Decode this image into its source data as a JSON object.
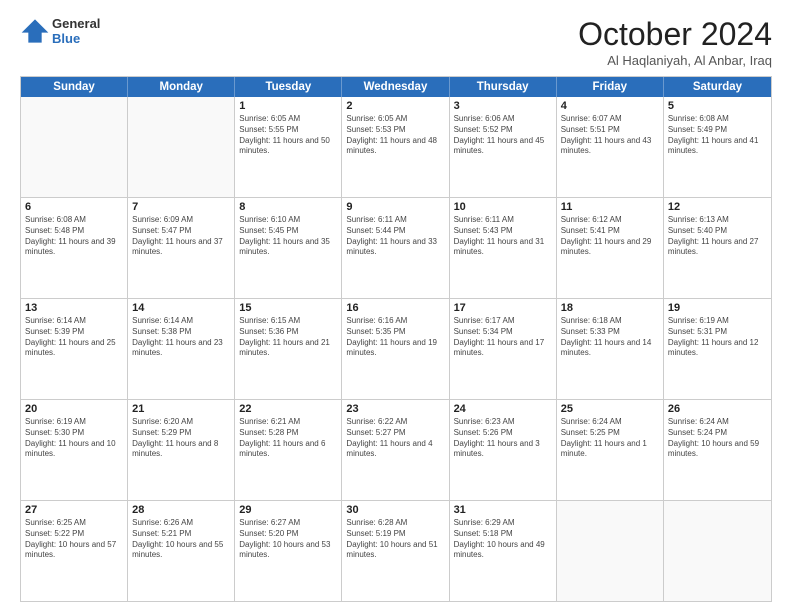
{
  "header": {
    "logo_general": "General",
    "logo_blue": "Blue",
    "month_title": "October 2024",
    "location": "Al Haqlaniyah, Al Anbar, Iraq"
  },
  "days_of_week": [
    "Sunday",
    "Monday",
    "Tuesday",
    "Wednesday",
    "Thursday",
    "Friday",
    "Saturday"
  ],
  "weeks": [
    [
      {
        "day": "",
        "empty": true
      },
      {
        "day": "",
        "empty": true
      },
      {
        "day": "1",
        "rise": "Sunrise: 6:05 AM",
        "set": "Sunset: 5:55 PM",
        "daylight": "Daylight: 11 hours and 50 minutes."
      },
      {
        "day": "2",
        "rise": "Sunrise: 6:05 AM",
        "set": "Sunset: 5:53 PM",
        "daylight": "Daylight: 11 hours and 48 minutes."
      },
      {
        "day": "3",
        "rise": "Sunrise: 6:06 AM",
        "set": "Sunset: 5:52 PM",
        "daylight": "Daylight: 11 hours and 45 minutes."
      },
      {
        "day": "4",
        "rise": "Sunrise: 6:07 AM",
        "set": "Sunset: 5:51 PM",
        "daylight": "Daylight: 11 hours and 43 minutes."
      },
      {
        "day": "5",
        "rise": "Sunrise: 6:08 AM",
        "set": "Sunset: 5:49 PM",
        "daylight": "Daylight: 11 hours and 41 minutes."
      }
    ],
    [
      {
        "day": "6",
        "rise": "Sunrise: 6:08 AM",
        "set": "Sunset: 5:48 PM",
        "daylight": "Daylight: 11 hours and 39 minutes."
      },
      {
        "day": "7",
        "rise": "Sunrise: 6:09 AM",
        "set": "Sunset: 5:47 PM",
        "daylight": "Daylight: 11 hours and 37 minutes."
      },
      {
        "day": "8",
        "rise": "Sunrise: 6:10 AM",
        "set": "Sunset: 5:45 PM",
        "daylight": "Daylight: 11 hours and 35 minutes."
      },
      {
        "day": "9",
        "rise": "Sunrise: 6:11 AM",
        "set": "Sunset: 5:44 PM",
        "daylight": "Daylight: 11 hours and 33 minutes."
      },
      {
        "day": "10",
        "rise": "Sunrise: 6:11 AM",
        "set": "Sunset: 5:43 PM",
        "daylight": "Daylight: 11 hours and 31 minutes."
      },
      {
        "day": "11",
        "rise": "Sunrise: 6:12 AM",
        "set": "Sunset: 5:41 PM",
        "daylight": "Daylight: 11 hours and 29 minutes."
      },
      {
        "day": "12",
        "rise": "Sunrise: 6:13 AM",
        "set": "Sunset: 5:40 PM",
        "daylight": "Daylight: 11 hours and 27 minutes."
      }
    ],
    [
      {
        "day": "13",
        "rise": "Sunrise: 6:14 AM",
        "set": "Sunset: 5:39 PM",
        "daylight": "Daylight: 11 hours and 25 minutes."
      },
      {
        "day": "14",
        "rise": "Sunrise: 6:14 AM",
        "set": "Sunset: 5:38 PM",
        "daylight": "Daylight: 11 hours and 23 minutes."
      },
      {
        "day": "15",
        "rise": "Sunrise: 6:15 AM",
        "set": "Sunset: 5:36 PM",
        "daylight": "Daylight: 11 hours and 21 minutes."
      },
      {
        "day": "16",
        "rise": "Sunrise: 6:16 AM",
        "set": "Sunset: 5:35 PM",
        "daylight": "Daylight: 11 hours and 19 minutes."
      },
      {
        "day": "17",
        "rise": "Sunrise: 6:17 AM",
        "set": "Sunset: 5:34 PM",
        "daylight": "Daylight: 11 hours and 17 minutes."
      },
      {
        "day": "18",
        "rise": "Sunrise: 6:18 AM",
        "set": "Sunset: 5:33 PM",
        "daylight": "Daylight: 11 hours and 14 minutes."
      },
      {
        "day": "19",
        "rise": "Sunrise: 6:19 AM",
        "set": "Sunset: 5:31 PM",
        "daylight": "Daylight: 11 hours and 12 minutes."
      }
    ],
    [
      {
        "day": "20",
        "rise": "Sunrise: 6:19 AM",
        "set": "Sunset: 5:30 PM",
        "daylight": "Daylight: 11 hours and 10 minutes."
      },
      {
        "day": "21",
        "rise": "Sunrise: 6:20 AM",
        "set": "Sunset: 5:29 PM",
        "daylight": "Daylight: 11 hours and 8 minutes."
      },
      {
        "day": "22",
        "rise": "Sunrise: 6:21 AM",
        "set": "Sunset: 5:28 PM",
        "daylight": "Daylight: 11 hours and 6 minutes."
      },
      {
        "day": "23",
        "rise": "Sunrise: 6:22 AM",
        "set": "Sunset: 5:27 PM",
        "daylight": "Daylight: 11 hours and 4 minutes."
      },
      {
        "day": "24",
        "rise": "Sunrise: 6:23 AM",
        "set": "Sunset: 5:26 PM",
        "daylight": "Daylight: 11 hours and 3 minutes."
      },
      {
        "day": "25",
        "rise": "Sunrise: 6:24 AM",
        "set": "Sunset: 5:25 PM",
        "daylight": "Daylight: 11 hours and 1 minute."
      },
      {
        "day": "26",
        "rise": "Sunrise: 6:24 AM",
        "set": "Sunset: 5:24 PM",
        "daylight": "Daylight: 10 hours and 59 minutes."
      }
    ],
    [
      {
        "day": "27",
        "rise": "Sunrise: 6:25 AM",
        "set": "Sunset: 5:22 PM",
        "daylight": "Daylight: 10 hours and 57 minutes."
      },
      {
        "day": "28",
        "rise": "Sunrise: 6:26 AM",
        "set": "Sunset: 5:21 PM",
        "daylight": "Daylight: 10 hours and 55 minutes."
      },
      {
        "day": "29",
        "rise": "Sunrise: 6:27 AM",
        "set": "Sunset: 5:20 PM",
        "daylight": "Daylight: 10 hours and 53 minutes."
      },
      {
        "day": "30",
        "rise": "Sunrise: 6:28 AM",
        "set": "Sunset: 5:19 PM",
        "daylight": "Daylight: 10 hours and 51 minutes."
      },
      {
        "day": "31",
        "rise": "Sunrise: 6:29 AM",
        "set": "Sunset: 5:18 PM",
        "daylight": "Daylight: 10 hours and 49 minutes."
      },
      {
        "day": "",
        "empty": true
      },
      {
        "day": "",
        "empty": true
      }
    ]
  ]
}
